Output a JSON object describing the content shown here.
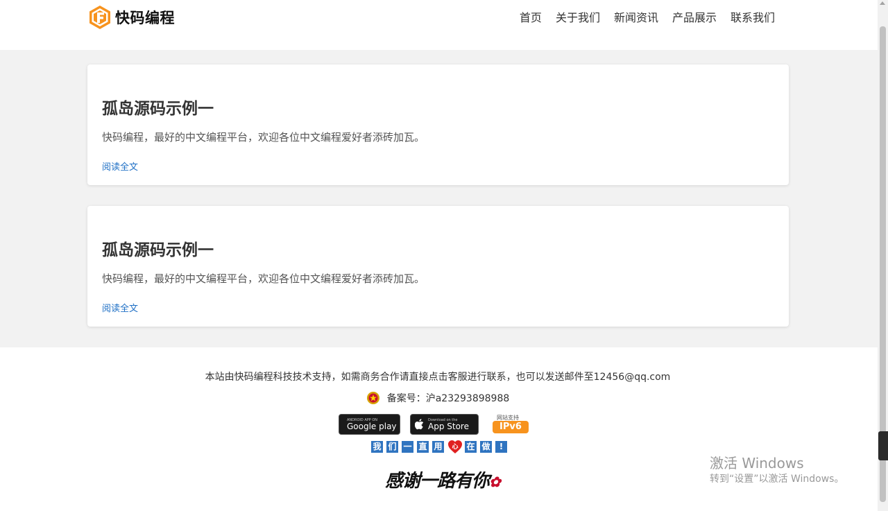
{
  "header": {
    "logo_text": "快码编程",
    "nav": [
      "首页",
      "关于我们",
      "新闻资讯",
      "产品展示",
      "联系我们"
    ]
  },
  "posts": [
    {
      "title": "孤岛源码示例一",
      "summary": "快码编程，最好的中文编程平台，欢迎各位中文编程爱好者添砖加瓦。",
      "link": "阅读全文"
    },
    {
      "title": "孤岛源码示例一",
      "summary": "快码编程，最好的中文编程平台，欢迎各位中文编程爱好者添砖加瓦。",
      "link": "阅读全文"
    }
  ],
  "footer": {
    "support_text": "本站由快码编程科技技术支持，如需商务合作请直接点击客服进行联系，也可以发送邮件至12456@qq.com",
    "record": "备案号：沪a23293898988",
    "google_play": {
      "small": "ANDROID APP ON",
      "big": "Google play"
    },
    "app_store": {
      "small": "Download on the",
      "big": "App Store"
    },
    "ipv6": {
      "small": "网站支持",
      "big": "IPv6"
    },
    "slogan": [
      "我",
      "们",
      "一",
      "直",
      "用",
      "心",
      "在",
      "做",
      "!"
    ],
    "thanks": "感谢一路有你"
  },
  "watermark": {
    "line1": "激活 Windows",
    "line2": "转到“设置”以激活 Windows。"
  },
  "colors": {
    "accent_link": "#1e6fc5",
    "logo_orange": "#f7931e",
    "slogan_blue": "#2f74c0"
  }
}
